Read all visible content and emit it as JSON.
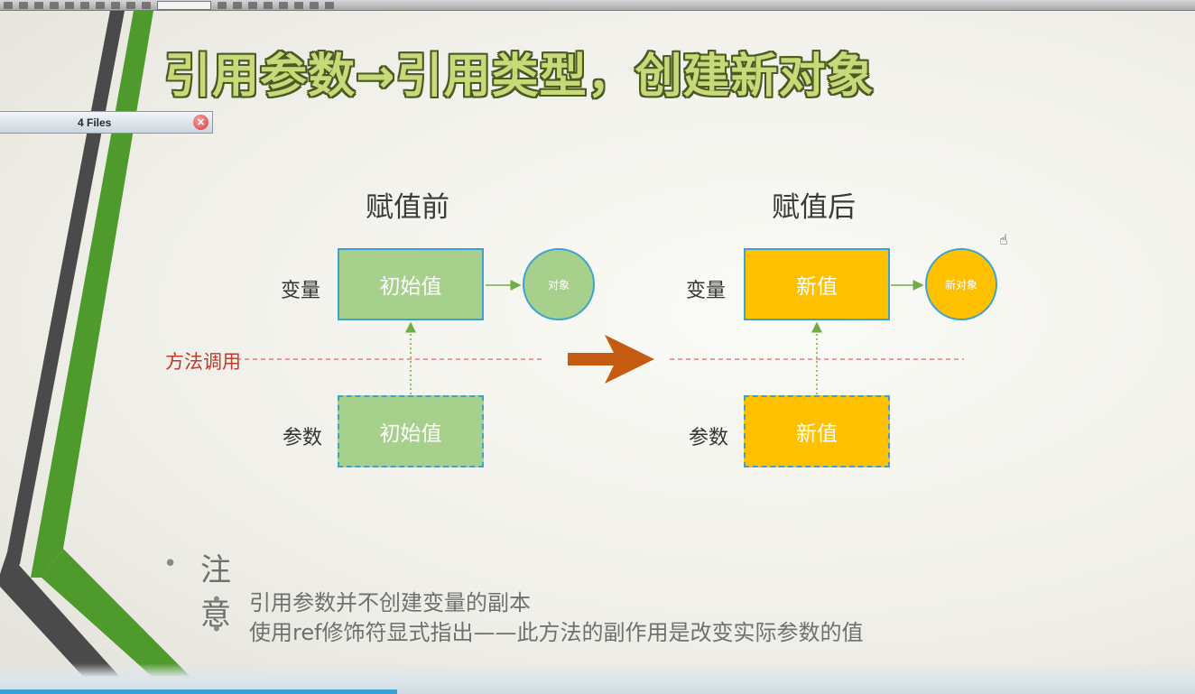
{
  "slide": {
    "title": "引用参数→引用类型，创建新对象",
    "call_label": "方法调用"
  },
  "files_pill": {
    "label": "4 Files",
    "close_icon": "close-icon"
  },
  "before": {
    "heading": "赋值前",
    "variable_label": "变量",
    "variable_value": "初始值",
    "object_label": "对象",
    "param_label": "参数",
    "param_value": "初始值",
    "color": "#a6d08b"
  },
  "after": {
    "heading": "赋值后",
    "variable_label": "变量",
    "variable_value": "新值",
    "object_label": "新对象",
    "param_label": "参数",
    "param_value": "新值",
    "color": "#ffc000"
  },
  "notes": {
    "title": "注意",
    "items": [
      "引用参数并不创建变量的副本",
      "使用ref修饰符显式指出——此方法的副作用是改变实际参数的值"
    ]
  },
  "colors": {
    "border": "#3ba3cf",
    "arrow": "#c55a11",
    "dashed_line": "#e06666",
    "connector": "#70ad47",
    "title_fill": "#c8d97a",
    "stripe_green": "#4f9a2d",
    "stripe_gray": "#4a4a4a"
  }
}
